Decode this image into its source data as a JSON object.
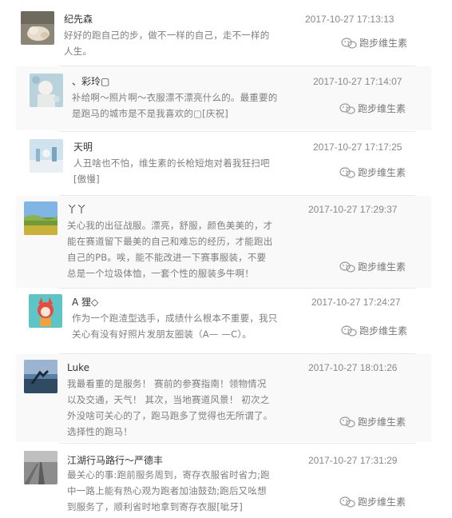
{
  "signature": "跑步维生素",
  "comments": [
    {
      "name": "纪先森",
      "time": "2017-10-27 17:13:13",
      "lines": [
        "好好的跑自己的步，做不一样的自己，走不一样的",
        "人生。"
      ]
    },
    {
      "name": "、彩玲▢",
      "time": "2017-10-27 17:14:07",
      "lines": [
        "补给啊～照片啊～衣服漂不漂亮什么的。最重要的",
        "是跑马的城市是不是我喜欢的▢[庆祝]"
      ]
    },
    {
      "name": "天明",
      "time": "2017-10-27 17:17:25",
      "lines": [
        "人丑啥也不怕，维生素的长枪短炮对着我狂扫吧",
        "[傲慢]"
      ]
    },
    {
      "name": "丫丫",
      "time": "2017-10-27 17:29:37",
      "lines": [
        "关心我的出征战服。漂亮，舒服，颜色美美的，才",
        "能在赛道留下最美的自己和难忘的经历，才能跑出",
        "自己的PB。唉，能不能改进一下赛事服装，不要",
        "总是一个垃圾体恤，一套个性的服装多牛啊！"
      ]
    },
    {
      "name": "A 狸◇",
      "time": "2017-10-27 17:24:27",
      "lines": [
        "作为一个跑渣型选手，成绩什么根本不重要，我只",
        "关心有没有好照片发朋友圈装（A— —C）。"
      ]
    },
    {
      "name": "Luke",
      "time": "2017-10-27 18:01:26",
      "lines": [
        "我最看重的是服务！ 赛前的参赛指南！领物情况",
        "以及交通，天气！ 其次，当地赛道风景！ 初次之",
        "外没啥可关心的了，跑马跑多了觉得也无所谓了。",
        "选择性的跑马！"
      ]
    },
    {
      "name": "江湖行马路行～严德丰",
      "time": "2017-10-27 17:31:29",
      "lines": [
        "最关心的事:跑前服务周到，寄存衣服省时省力;跑",
        "中一路上能有热心观为跑者加油鼓劲;跑后又吆想",
        "到服务了，顺利省时地拿到寄存衣服[呲牙]"
      ]
    }
  ]
}
